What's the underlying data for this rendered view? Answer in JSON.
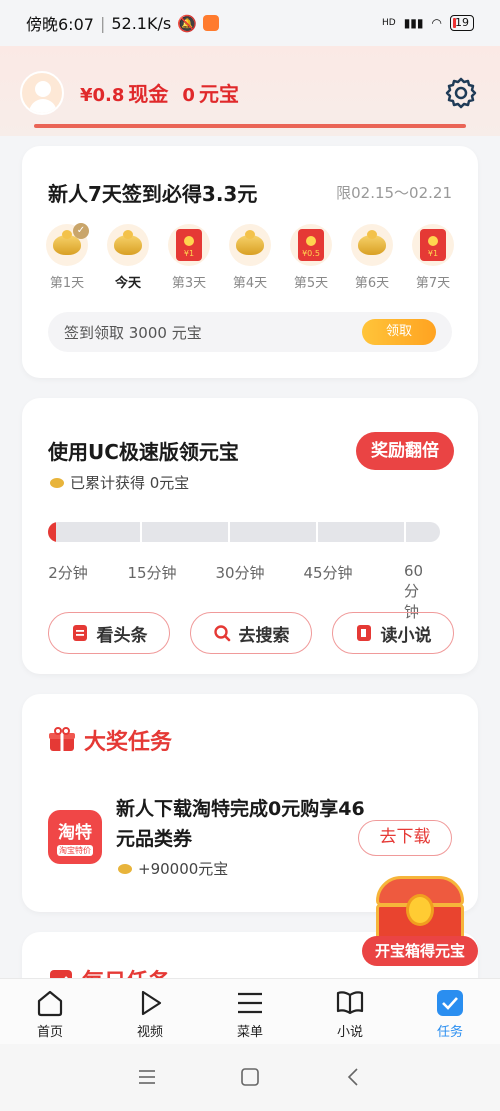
{
  "status_bar": {
    "time": "傍晚6:07",
    "network_speed": "52.1K/s",
    "signal_label": "HD",
    "battery": "19"
  },
  "header": {
    "cash_amount": "¥0.8",
    "cash_label": "现金",
    "ingot_amount": "0",
    "ingot_label": "元宝"
  },
  "signin": {
    "title": "新人7天签到必得3.3元",
    "limit": "限02.15～02.21",
    "days": [
      {
        "label": "第1天",
        "reward": "ingot",
        "done": true
      },
      {
        "label": "今天",
        "reward": "ingot",
        "today": true
      },
      {
        "label": "第3天",
        "reward": "envelope",
        "value": "¥1"
      },
      {
        "label": "第4天",
        "reward": "ingot"
      },
      {
        "label": "第5天",
        "reward": "envelope",
        "value": "¥0.5"
      },
      {
        "label": "第6天",
        "reward": "ingot"
      },
      {
        "label": "第7天",
        "reward": "envelope",
        "value": "¥1"
      }
    ],
    "bar_text": "签到领取 3000 元宝",
    "claim_label": "领取"
  },
  "uc_task": {
    "title": "使用UC极速版领元宝",
    "badge": "奖励翻倍",
    "earned": "已累计获得 0元宝",
    "progress": 0.02,
    "milestones": [
      "2分钟",
      "15分钟",
      "30分钟",
      "45分钟",
      "60分钟"
    ],
    "actions": [
      {
        "label": "看头条",
        "icon": "news-icon"
      },
      {
        "label": "去搜索",
        "icon": "search-icon"
      },
      {
        "label": "读小说",
        "icon": "book-icon"
      }
    ]
  },
  "prize": {
    "title": "大奖任务",
    "logo_main": "淘特",
    "logo_sub": "淘宝特价",
    "task_title": "新人下载淘特完成0元购享46元品类券",
    "reward": "+90000元宝",
    "button": "去下载"
  },
  "daily": {
    "title": "每日任务"
  },
  "chest": {
    "label": "开宝箱得元宝"
  },
  "bottom_nav": [
    {
      "label": "首页",
      "icon": "home-icon"
    },
    {
      "label": "视频",
      "icon": "play-icon"
    },
    {
      "label": "菜单",
      "icon": "menu-icon"
    },
    {
      "label": "小说",
      "icon": "book-icon"
    },
    {
      "label": "任务",
      "icon": "task-check-icon",
      "active": true
    }
  ],
  "colors": {
    "accent_red": "#e53935",
    "active_blue": "#2a8ef0",
    "gold": "#ffa321"
  }
}
